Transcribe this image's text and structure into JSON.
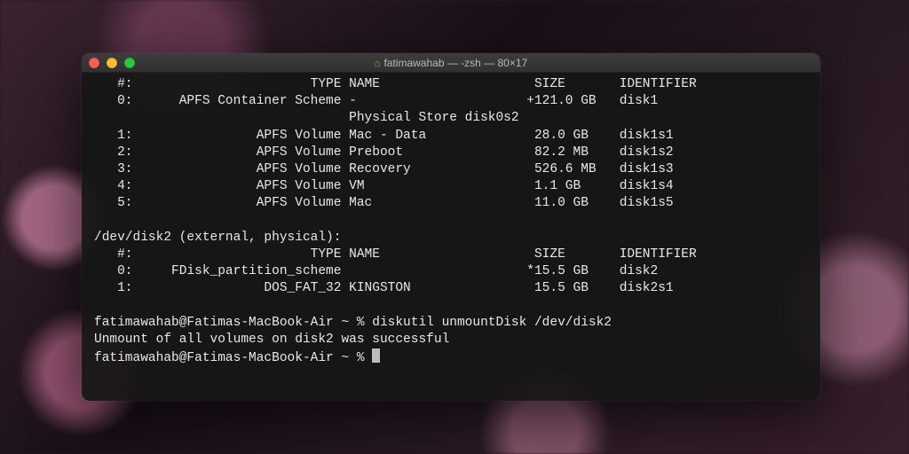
{
  "window": {
    "title": "fatimawahab — -zsh — 80×17"
  },
  "header": {
    "row": "   #:                       TYPE NAME                    SIZE       IDENTIFIER"
  },
  "disk1": {
    "row0": "   0:      APFS Container Scheme -                      +121.0 GB   disk1",
    "store": "                                 Physical Store disk0s2",
    "row1": "   1:                APFS Volume Mac - Data              28.0 GB    disk1s1",
    "row2": "   2:                APFS Volume Preboot                 82.2 MB    disk1s2",
    "row3": "   3:                APFS Volume Recovery                526.6 MB   disk1s3",
    "row4": "   4:                APFS Volume VM                      1.1 GB     disk1s4",
    "row5": "   5:                APFS Volume Mac                     11.0 GB    disk1s5"
  },
  "disk2": {
    "title": "/dev/disk2 (external, physical):",
    "header": "   #:                       TYPE NAME                    SIZE       IDENTIFIER",
    "row0": "   0:     FDisk_partition_scheme                        *15.5 GB    disk2",
    "row1": "   1:                 DOS_FAT_32 KINGSTON                15.5 GB    disk2s1"
  },
  "cmd": {
    "line1": "fatimawahab@Fatimas-MacBook-Air ~ % diskutil unmountDisk /dev/disk2",
    "line2": "Unmount of all volumes on disk2 was successful",
    "prompt": "fatimawahab@Fatimas-MacBook-Air ~ % "
  }
}
